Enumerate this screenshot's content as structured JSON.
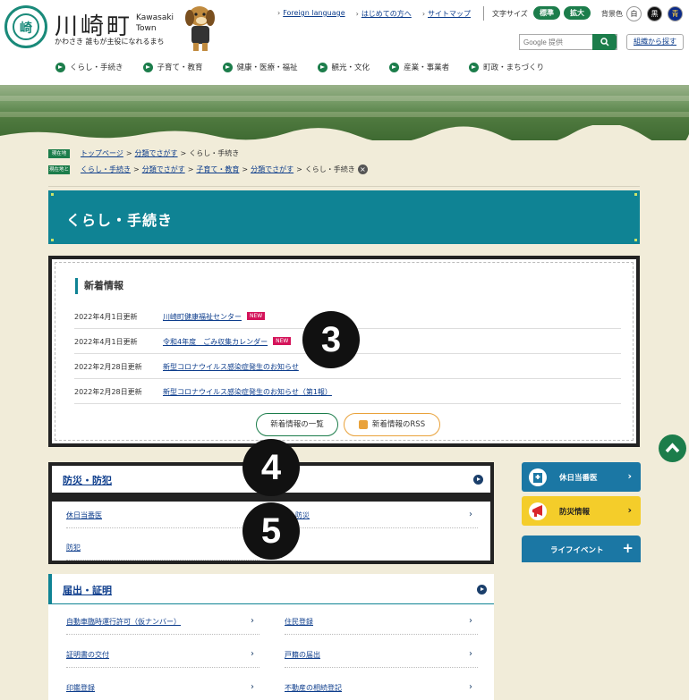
{
  "header": {
    "town_name": "川崎町",
    "town_name_en_1": "Kawasaki",
    "town_name_en_2": "Town",
    "tagline": "かわさき 誰もが主役になれるまち",
    "emblem_glyph": "崎",
    "util_links": [
      "Foreign language",
      "はじめての方へ",
      "サイトマップ"
    ],
    "font_size_label": "文字サイズ",
    "font_size_normal": "標準",
    "font_size_large": "拡大",
    "bg_color_label": "背景色",
    "bg_white": "白",
    "bg_black": "黒",
    "bg_blue": "青",
    "search_placeholder": "Google 提供",
    "org_search": "組織から探す"
  },
  "global_nav": [
    "くらし・手続き",
    "子育て・教育",
    "健康・医療・福祉",
    "観光・文化",
    "産業・事業者",
    "町政・まちづくり"
  ],
  "breadcrumb": {
    "current_tag": "現在地",
    "current": [
      "トップページ",
      "分類でさがす",
      "くらし・手続き"
    ],
    "path_tag": "現在地と",
    "path": [
      "くらし・手続き",
      "分類でさがす",
      "子育て・教育",
      "分類でさがす",
      "くらし・手続き"
    ],
    "close_icon": "×"
  },
  "page_title": "くらし・手続き",
  "news": {
    "heading": "新着情報",
    "items": [
      {
        "date": "2022年4月1日更新",
        "title": "川崎町健康福祉センター",
        "new": "NEW"
      },
      {
        "date": "2022年4月1日更新",
        "title": "令和4年度　ごみ収集カレンダー",
        "new": "NEW"
      },
      {
        "date": "2022年2月28日更新",
        "title": "新型コロナウイルス感染症発生のお知らせ",
        "new": ""
      },
      {
        "date": "2022年2月28日更新",
        "title": "新型コロナウイルス感染症発生のお知らせ（第1報）",
        "new": ""
      }
    ],
    "list_button": "新着情報の一覧",
    "rss_button": "新着情報のRSS"
  },
  "badges": [
    "3",
    "4",
    "5"
  ],
  "categories": {
    "disaster": {
      "title": "防災・防犯",
      "links": [
        "休日当番医",
        "防災",
        "防犯"
      ]
    },
    "certificate": {
      "title": "届出・証明",
      "links": [
        "自動車臨時運行許可（仮ナンバー）",
        "住民登録",
        "証明書の交付",
        "戸籍の届出",
        "印鑑登録",
        "不動産の相続登記"
      ]
    }
  },
  "side": {
    "holiday_doctor": "休日当番医",
    "disaster_info": "防災情報",
    "life_event": "ライフイベント"
  },
  "colors": {
    "teal": "#0f8394",
    "green": "#1c7d4b",
    "yellow": "#f4cd2a",
    "new_badge": "#d4145a"
  }
}
